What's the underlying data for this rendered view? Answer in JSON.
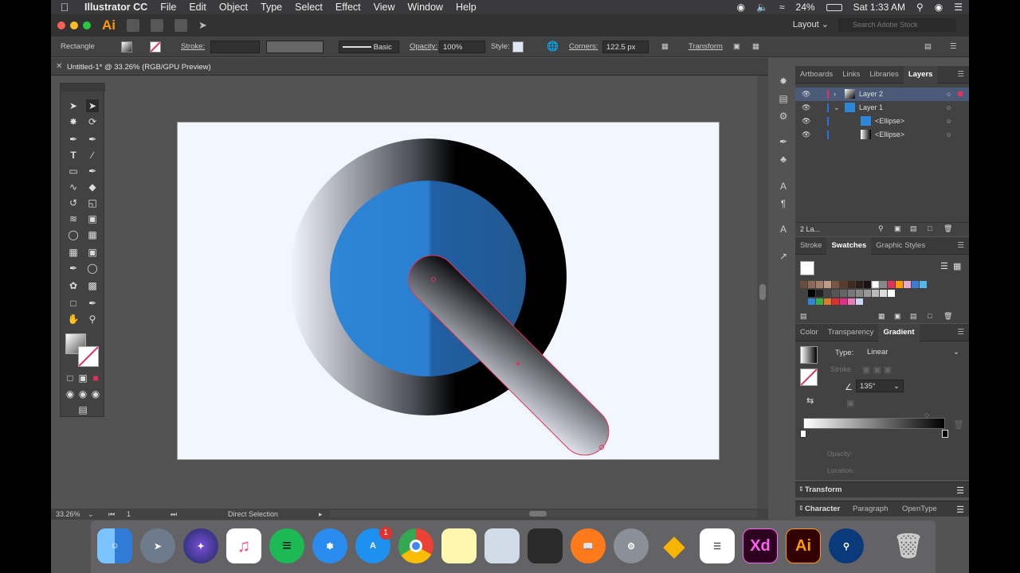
{
  "menubar": {
    "app": "Illustrator CC",
    "items": [
      "File",
      "Edit",
      "Object",
      "Type",
      "Select",
      "Effect",
      "View",
      "Window",
      "Help"
    ],
    "battery": "24%",
    "time": "Sat 1:33 AM"
  },
  "appbar": {
    "logo": "Ai",
    "layout": "Layout",
    "search_placeholder": "Search Adobe Stock"
  },
  "control": {
    "object_type": "Rectangle",
    "stroke_label": "Stroke:",
    "brush_label": "Basic",
    "opacity_label": "Opacity:",
    "opacity_value": "100%",
    "style_label": "Style:",
    "corners_label": "Corners:",
    "corners_value": "122.5 px",
    "transform_label": "Transform"
  },
  "document": {
    "tab_title": "Untitled-1* @ 33.26% (RGB/GPU Preview)"
  },
  "status": {
    "zoom": "33.26%",
    "artboard": "1",
    "tool": "Direct Selection"
  },
  "layers_panel": {
    "tabs": [
      "Artboards",
      "Links",
      "Libraries",
      "Layers"
    ],
    "active_tab": "Layers",
    "rows": [
      {
        "name": "Layer 2"
      },
      {
        "name": "Layer 1"
      },
      {
        "name": "<Ellipse>"
      },
      {
        "name": "<Ellipse>"
      }
    ],
    "count": "2 La..."
  },
  "swatches_panel": {
    "tabs": [
      "Stroke",
      "Swatches",
      "Graphic Styles"
    ],
    "active_tab": "Swatches"
  },
  "gradient_panel": {
    "tabs": [
      "Color",
      "Transparency",
      "Gradient"
    ],
    "active_tab": "Gradient",
    "type_label": "Type:",
    "type_value": "Linear",
    "stroke_label": "Stroke",
    "angle": "135°",
    "opacity_label": "Opacity:",
    "location_label": "Location:"
  },
  "collapsed_panels": {
    "transform": "Transform",
    "tabs": [
      "Character",
      "Paragraph",
      "OpenType"
    ]
  },
  "dock": {
    "appstore_badge": "1",
    "xd_label": "Xd",
    "ai_label": "Ai"
  },
  "colors": {
    "accent_blue": "#2e86d6",
    "selection": "#e0325a",
    "ai_orange": "#ff9a00"
  }
}
